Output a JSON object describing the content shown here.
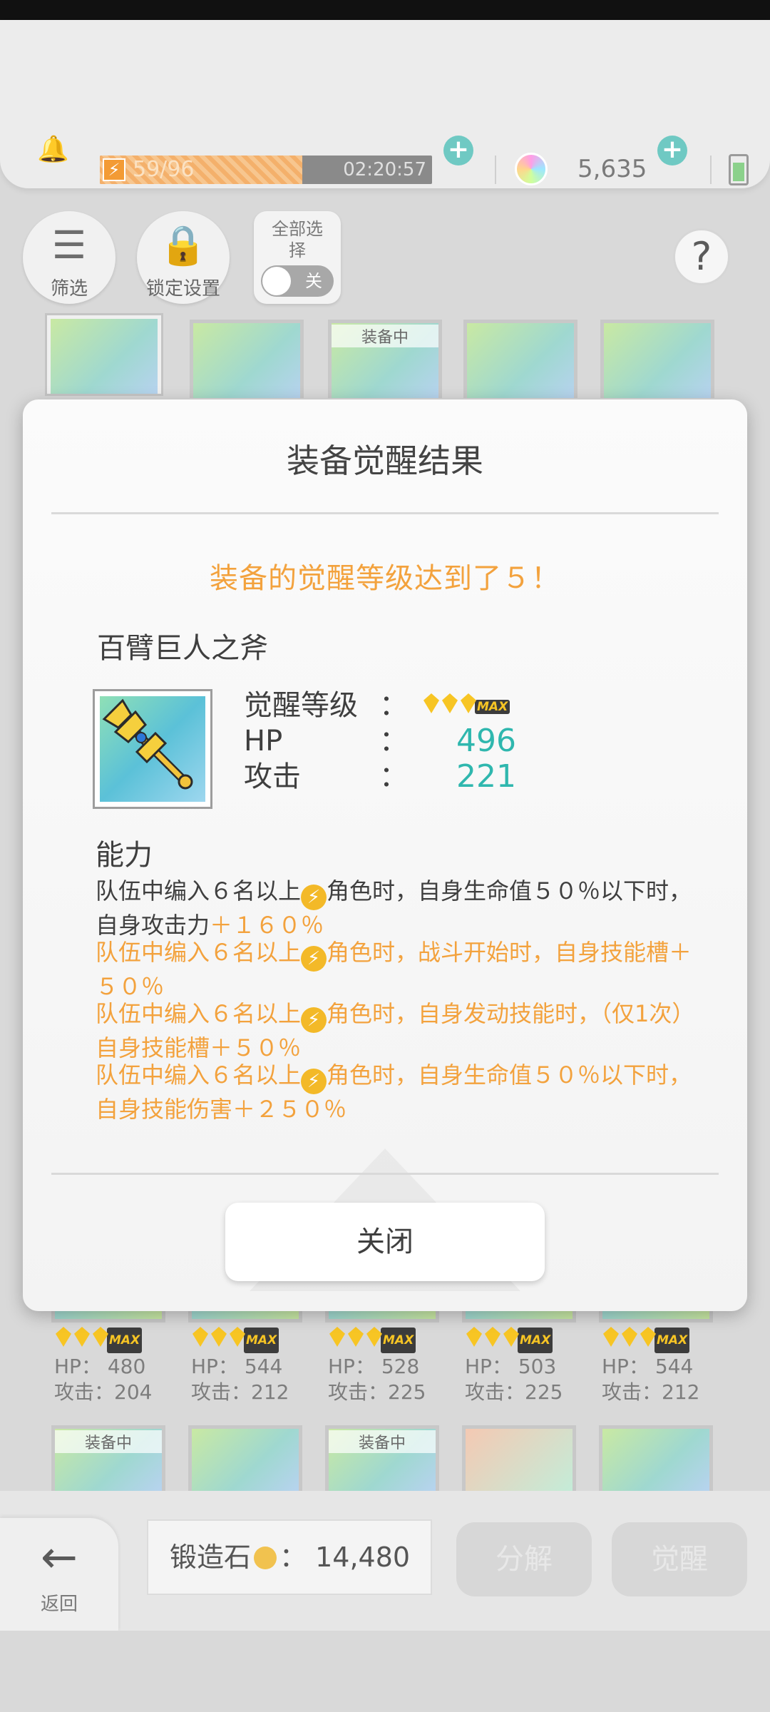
{
  "status": {
    "stamina_text": "59/96",
    "stamina_fraction": 0.61,
    "stamina_timer": "02:20:57",
    "gem_count": "5,635"
  },
  "toolbar": {
    "filter_label": "筛选",
    "lock_label": "锁定设置",
    "select_all_label": "全部选择",
    "toggle_label": "关"
  },
  "cards_top": [
    {
      "badge": ""
    },
    {
      "badge": ""
    },
    {
      "badge": "装备中"
    },
    {
      "badge": ""
    },
    {
      "badge": ""
    }
  ],
  "cards_row2": [
    {
      "hp": "HP： 480",
      "atk": "攻击：204"
    },
    {
      "hp": "HP： 544",
      "atk": "攻击：212"
    },
    {
      "hp": "HP： 528",
      "atk": "攻击：225"
    },
    {
      "hp": "HP： 503",
      "atk": "攻击：225"
    },
    {
      "hp": "HP： 544",
      "atk": "攻击：212"
    }
  ],
  "cards_row3": [
    {
      "badge": "装备中"
    },
    {
      "badge": ""
    },
    {
      "badge": "装备中"
    },
    {
      "badge": ""
    },
    {
      "badge": ""
    }
  ],
  "max_tag": "MAX",
  "bottom": {
    "back_label": "返回",
    "forge_label": "锻造石",
    "forge_count": "： 14,480",
    "dismantle_label": "分解",
    "awaken_label": "觉醒"
  },
  "modal": {
    "title": "装备觉醒结果",
    "headline": "装备的觉醒等级达到了５！",
    "item_name": "百臂巨人之斧",
    "awaken_level_label": "觉醒等级",
    "hp_label": "HP",
    "hp_value": "496",
    "atk_label": "攻击",
    "atk_value": "221",
    "colon": "：",
    "ability_label": "能力",
    "abilities": [
      {
        "pre": "队伍中编入６名以上",
        "post": "角色时，自身生命值５０％以下时，自身攻击力",
        "bonus": "＋１６０％"
      },
      {
        "pre": "队伍中编入６名以上",
        "post": "角色时，战斗开始时，自身技能槽＋５０％",
        "bonus": ""
      },
      {
        "pre": "队伍中编入６名以上",
        "post": "角色时，自身发动技能时，（仅1次）自身技能槽＋５０％",
        "bonus": ""
      },
      {
        "pre": "队伍中编入６名以上",
        "post": "角色时，自身生命值５０％以下时，自身技能伤害＋２５０％",
        "bonus": ""
      }
    ],
    "close_label": "关闭"
  }
}
